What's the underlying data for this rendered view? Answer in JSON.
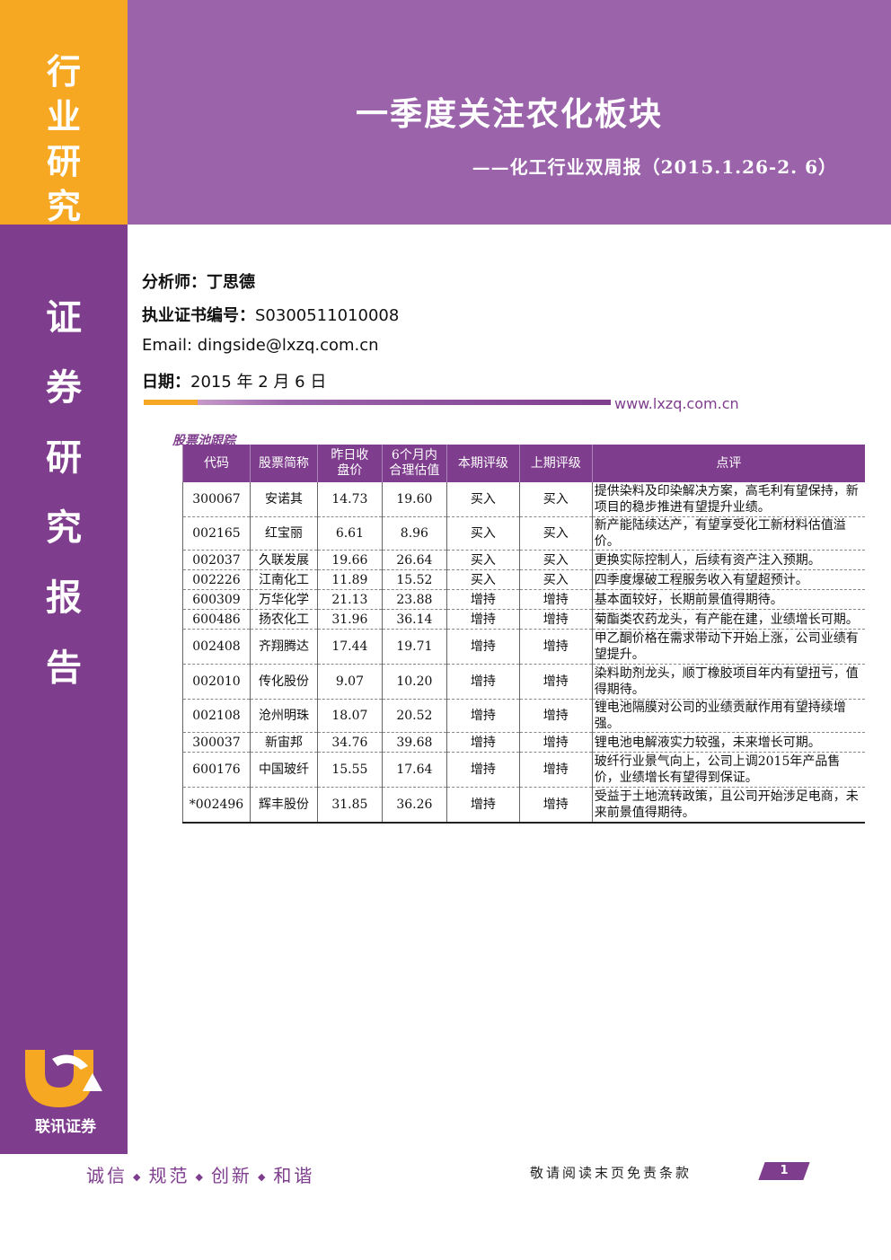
{
  "sidebar": {
    "top_chars": [
      "行",
      "业",
      "研",
      "究"
    ],
    "main_chars": [
      "证",
      "券",
      "研",
      "究",
      "报",
      "告"
    ],
    "logo_text": "联讯证券"
  },
  "header": {
    "title": "一季度关注农化板块",
    "subtitle": "——化工行业双周报（2015.1.26-2. 6）"
  },
  "info": {
    "analyst_label": "分析师：",
    "analyst": "丁思德",
    "cert_label": "执业证书编号：",
    "cert": "S0300511010008",
    "email": "Email: dingside@lxzq.com.cn",
    "date_label": "日期：",
    "date": "2015 年 2 月 6 日",
    "website": "www.lxzq.com.cn"
  },
  "table": {
    "caption": "股票池跟踪",
    "headers": [
      "代码",
      "股票简称",
      "昨日收\n盘价",
      "6个月内\n合理估值",
      "本期评级",
      "上期评级",
      "点评"
    ],
    "rows": [
      [
        "300067",
        "安诺其",
        "14.73",
        "19.60",
        "买入",
        "买入",
        "提供染料及印染解决方案，高毛利有望保持，新项目的稳步推进有望提升业绩。"
      ],
      [
        "002165",
        "红宝丽",
        "6.61",
        "8.96",
        "买入",
        "买入",
        "新产能陆续达产，有望享受化工新材料估值溢价。"
      ],
      [
        "002037",
        "久联发展",
        "19.66",
        "26.64",
        "买入",
        "买入",
        "更换实际控制人，后续有资产注入预期。"
      ],
      [
        "002226",
        "江南化工",
        "11.89",
        "15.52",
        "买入",
        "买入",
        "四季度爆破工程服务收入有望超预计。"
      ],
      [
        "600309",
        "万华化学",
        "21.13",
        "23.88",
        "增持",
        "增持",
        "基本面较好，长期前景值得期待。"
      ],
      [
        "600486",
        "扬农化工",
        "31.96",
        "36.14",
        "增持",
        "增持",
        "菊酯类农药龙头，有产能在建，业绩增长可期。"
      ],
      [
        "002408",
        "齐翔腾达",
        "17.44",
        "19.71",
        "增持",
        "增持",
        "甲乙酮价格在需求带动下开始上涨，公司业绩有望提升。"
      ],
      [
        "002010",
        "传化股份",
        "9.07",
        "10.20",
        "增持",
        "增持",
        "染料助剂龙头，顺丁橡胶项目年内有望扭亏，值得期待。"
      ],
      [
        "002108",
        "沧州明珠",
        "18.07",
        "20.52",
        "增持",
        "增持",
        "锂电池隔膜对公司的业绩贡献作用有望持续增强。"
      ],
      [
        "300037",
        "新宙邦",
        "34.76",
        "39.68",
        "增持",
        "增持",
        "锂电池电解液实力较强，未来增长可期。"
      ],
      [
        "600176",
        "中国玻纤",
        "15.55",
        "17.64",
        "增持",
        "增持",
        "玻纤行业景气向上，公司上调2015年产品售价，业绩增长有望得到保证。"
      ],
      [
        "*002496",
        "辉丰股份",
        "31.85",
        "36.26",
        "增持",
        "增持",
        "受益于土地流转政策，且公司开始涉足电商，未来前景值得期待。"
      ]
    ]
  },
  "footer": {
    "motto": [
      "诚信",
      "规范",
      "创新",
      "和谐"
    ],
    "disclaimer": "敬请阅读末页免责条款",
    "page": "1"
  },
  "colors": {
    "orange": "#f7a823",
    "purple_dark": "#7f3d8d",
    "purple_light": "#9a63aa"
  }
}
